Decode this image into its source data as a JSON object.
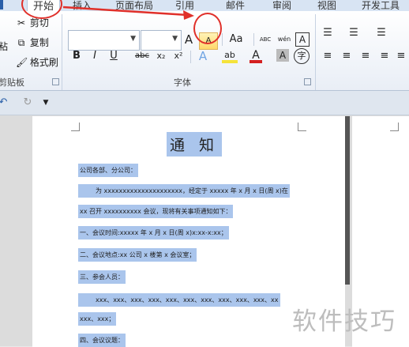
{
  "ribbon": {
    "tabs": {
      "home": "开始",
      "insert": "插入",
      "page_layout": "页面布局",
      "references": "引用",
      "mailings": "邮件",
      "review": "审阅",
      "view": "视图",
      "developer": "开发工具"
    },
    "clipboard": {
      "paste_label": "粘",
      "cut": "剪切",
      "copy": "复制",
      "format_painter": "格式刷",
      "group_label": "剪贴板"
    },
    "font": {
      "group_label": "字体",
      "grow_font": "A",
      "shrink_font": "A",
      "change_case": "Aa",
      "clear_format": "ABC",
      "phonetic": "wén",
      "char_border": "A",
      "bold": "B",
      "italic": "I",
      "underline": "U",
      "strikethrough": "abc",
      "subscript": "x₂",
      "superscript": "x²",
      "text_effects": "A",
      "highlight": "ab",
      "font_color": "A",
      "char_shading": "A",
      "enclose_char": "字"
    },
    "colors": {
      "font_color": "#d42020",
      "highlight": "#f5e33a",
      "text_effects": "#3a78c8"
    }
  },
  "document": {
    "title": "通 知",
    "lines": [
      "公司各部、分公司：",
      "为 xxxxxxxxxxxxxxxxxxxxx，经定于 xxxxx 年 x 月 x 日(周 x)在",
      "xx 召开 xxxxxxxxxx 会议，现将有关事项通知如下：",
      "一、会议时间:xxxxx 年 x 月 x 日(周 x)x:xx-x:xx；",
      "二、会议地点:xx 公司 x 楼第 x 会议室；",
      "三、参会人员：",
      "xxx、xxx、xxx、xxx、xxx、xxx、xxx、xxx、xxx、xxx、xx",
      "xxx、xxx；",
      "四、会议议题："
    ]
  },
  "watermark": "软件技巧"
}
